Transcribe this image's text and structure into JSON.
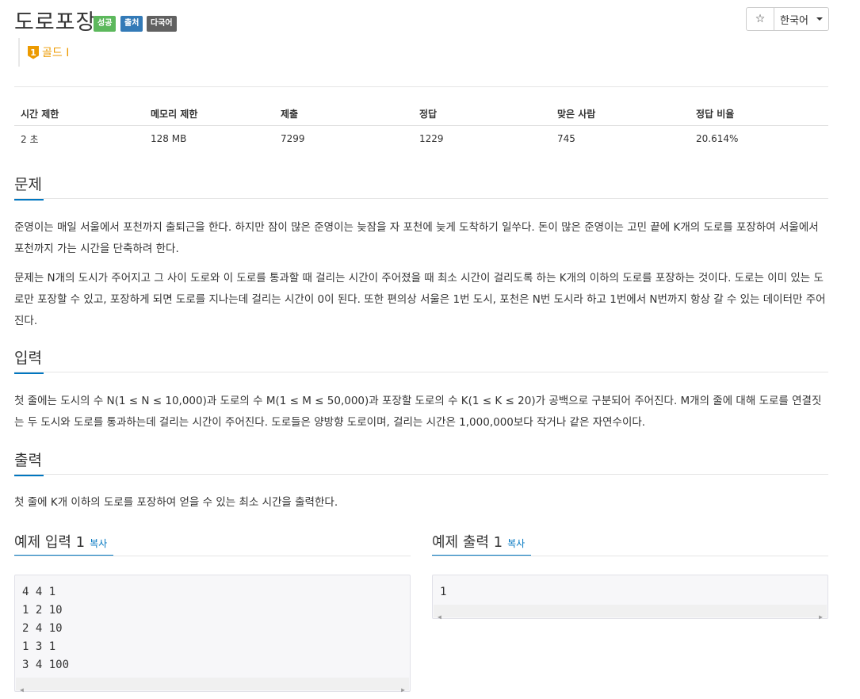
{
  "problem": {
    "title": "도로포장",
    "badges": [
      "성공",
      "출처",
      "다국어"
    ],
    "tier": {
      "num": "1",
      "label": "골드 I"
    }
  },
  "topbar": {
    "star": "☆",
    "language": "한국어"
  },
  "stats": {
    "headers": [
      "시간 제한",
      "메모리 제한",
      "제출",
      "정답",
      "맞은 사람",
      "정답 비율"
    ],
    "values": [
      "2 초",
      "128 MB",
      "7299",
      "1229",
      "745",
      "20.614%"
    ]
  },
  "sections": {
    "problem": {
      "title": "문제",
      "paragraphs": [
        "준영이는 매일 서울에서 포천까지 출퇴근을 한다. 하지만 잠이 많은 준영이는 늦잠을 자 포천에 늦게 도착하기 일쑤다. 돈이 많은 준영이는 고민 끝에 K개의 도로를 포장하여 서울에서 포천까지 가는 시간을 단축하려 한다.",
        "문제는 N개의 도시가 주어지고 그 사이 도로와 이 도로를 통과할 때 걸리는 시간이 주어졌을 때 최소 시간이 걸리도록 하는 K개의 이하의 도로를 포장하는 것이다. 도로는 이미 있는 도로만 포장할 수 있고, 포장하게 되면 도로를 지나는데 걸리는 시간이 0이 된다. 또한 편의상 서울은 1번 도시, 포천은 N번 도시라 하고 1번에서 N번까지 항상 갈 수 있는 데이터만 주어진다."
      ]
    },
    "input": {
      "title": "입력",
      "paragraphs": [
        "첫 줄에는 도시의 수 N(1 ≤ N ≤ 10,000)과 도로의 수 M(1 ≤ M ≤ 50,000)과 포장할 도로의 수 K(1 ≤ K ≤ 20)가 공백으로 구분되어 주어진다. M개의 줄에 대해 도로를 연결짓는 두 도시와 도로를 통과하는데 걸리는 시간이 주어진다. 도로들은 양방향 도로이며, 걸리는 시간은 1,000,000보다 작거나 같은 자연수이다."
      ]
    },
    "output": {
      "title": "출력",
      "paragraphs": [
        "첫 줄에 K개 이하의 도로를 포장하여 얻을 수 있는 최소 시간을 출력한다."
      ]
    }
  },
  "samples": {
    "input": {
      "title": "예제 입력 1",
      "copy": "복사",
      "text": "4 4 1\n1 2 10\n2 4 10\n1 3 1\n3 4 100"
    },
    "output": {
      "title": "예제 출력 1",
      "copy": "복사",
      "text": "1"
    }
  },
  "icons": {
    "scroll_left": "◀",
    "scroll_right": "▶"
  }
}
